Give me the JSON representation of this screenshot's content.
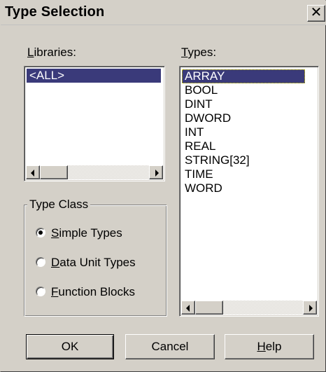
{
  "dialog": {
    "title": "Type Selection",
    "close_glyph": "✕"
  },
  "libraries": {
    "label_prefix": "",
    "label_accel": "L",
    "label_rest": "ibraries:",
    "items": [
      "<ALL>"
    ],
    "selected_index": 0
  },
  "types": {
    "label_accel": "T",
    "label_rest": "ypes:",
    "items": [
      "ARRAY",
      "BOOL",
      "DINT",
      "DWORD",
      "INT",
      "REAL",
      "STRING[32]",
      "TIME",
      "WORD"
    ],
    "selected_index": 0
  },
  "type_class": {
    "legend": "Type Class",
    "options": [
      {
        "accel": "S",
        "rest": "imple Types",
        "selected": true
      },
      {
        "accel": "D",
        "rest": "ata Unit Types",
        "selected": false
      },
      {
        "accel": "F",
        "rest": "unction Blocks",
        "selected": false
      }
    ]
  },
  "buttons": {
    "ok": "OK",
    "cancel": "Cancel",
    "help_accel": "H",
    "help_rest": "elp"
  },
  "icons": {
    "scroll_left": "scroll-left-arrow-icon",
    "scroll_right": "scroll-right-arrow-icon",
    "close": "close-icon"
  }
}
